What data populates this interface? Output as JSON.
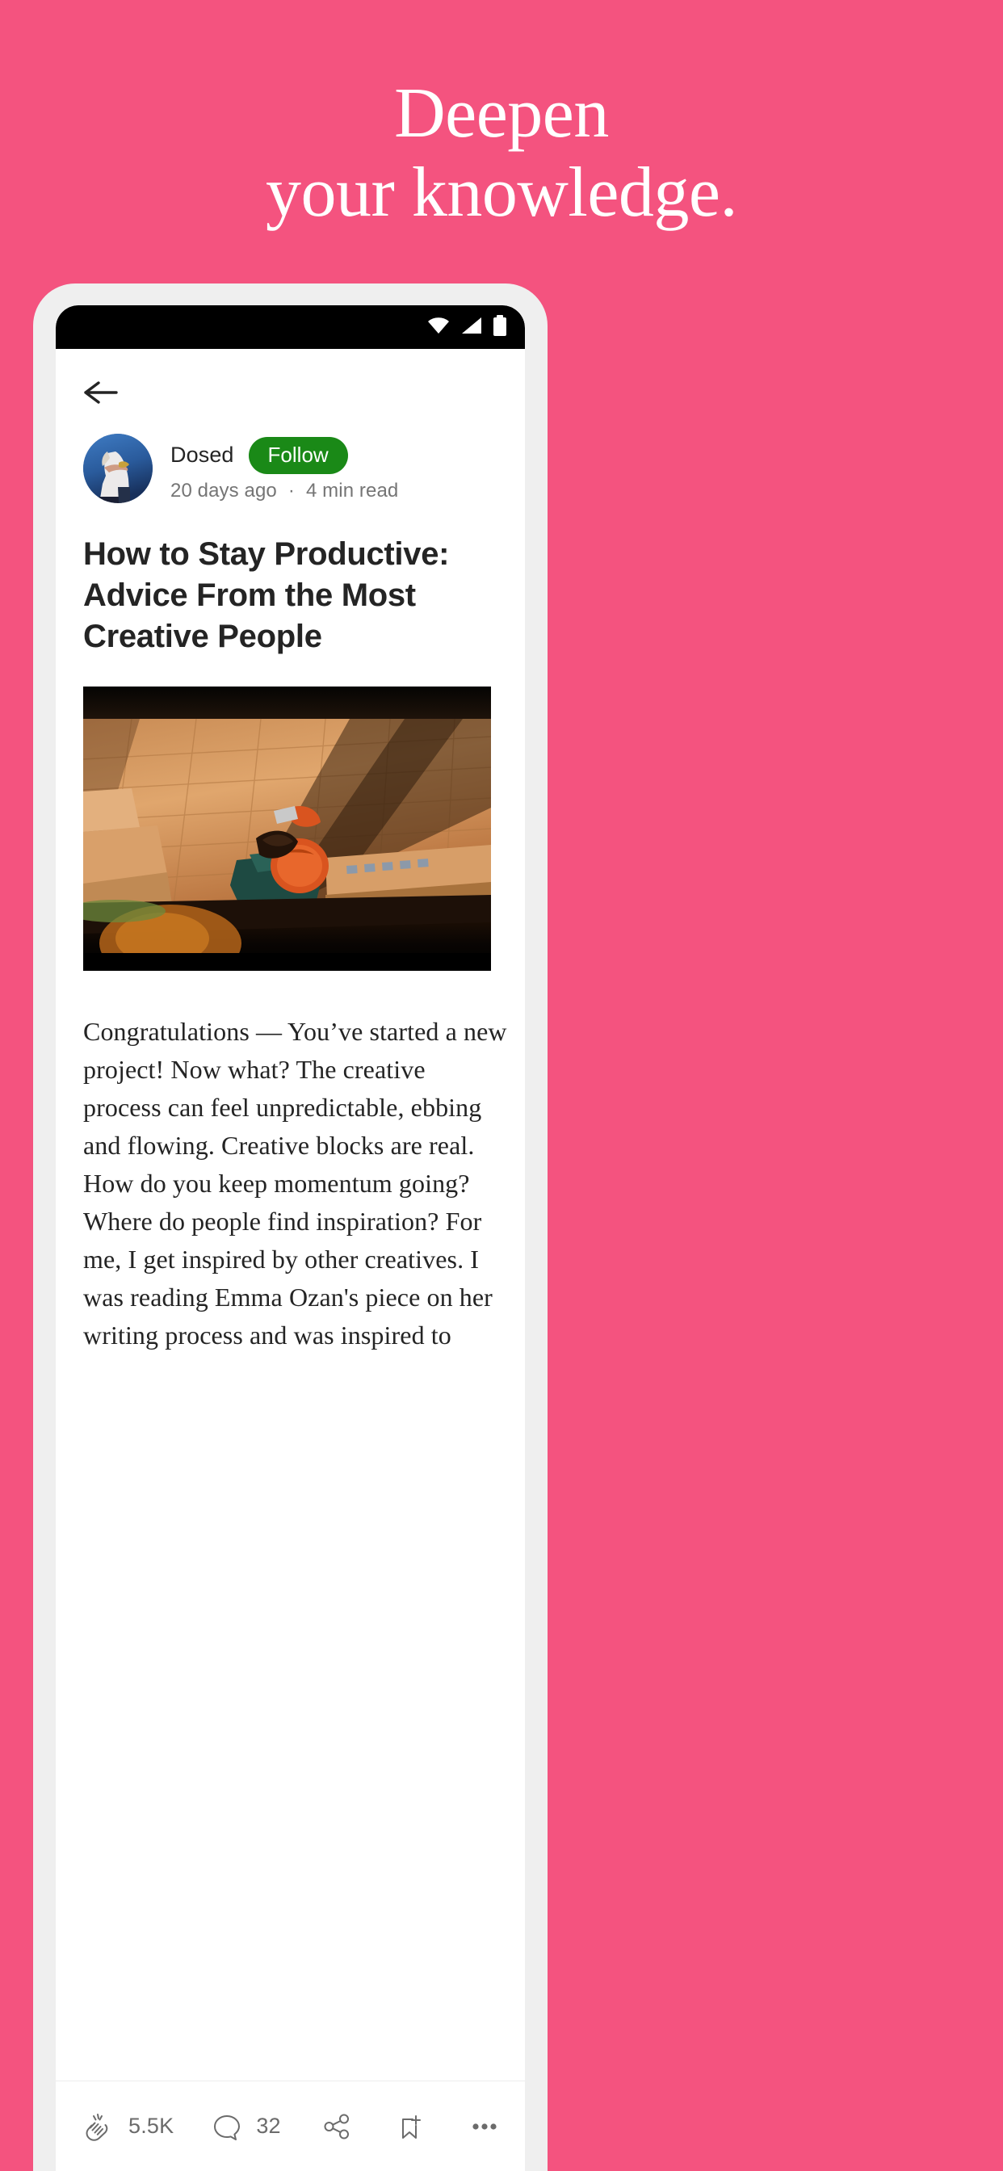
{
  "hero": {
    "line1": "Deepen",
    "line2": "your knowledge.",
    "background_color": "#f4537f",
    "text_color": "#ffffff"
  },
  "phone": {
    "status_bar": {
      "wifi_icon": "wifi-icon",
      "signal_icon": "signal-icon",
      "battery_icon": "battery-icon",
      "background_color": "#000000"
    },
    "nav": {
      "back_icon": "back-arrow-icon"
    },
    "article": {
      "author": {
        "name": "Dosed",
        "avatar_icon": "avatar",
        "follow_label": "Follow",
        "follow_color": "#1a8917"
      },
      "meta": {
        "published": "20 days ago",
        "separator": "·",
        "read_time": "4 min read"
      },
      "title": "How to Stay Productive: Advice From the Most Creative People",
      "hero_image_alt": "person-sitting-on-terracotta-steps",
      "body": "Congratulations — You’ve started a new project! Now what? The creative process can feel unpredictable, ebbing and flowing. Creative blocks are real. How do you keep momentum going? Where do people find inspiration? For me, I get inspired by other creatives. I was reading Emma Ozan's piece on her writing process and was inspired to"
    },
    "toolbar": {
      "clap_icon": "clap-icon",
      "clap_count": "5.5K",
      "comment_icon": "comment-icon",
      "comment_count": "32",
      "share_icon": "share-icon",
      "bookmark_icon": "bookmark-add-icon",
      "more_icon": "more-horizontal-icon",
      "icon_color": "#6b6b6b"
    }
  }
}
